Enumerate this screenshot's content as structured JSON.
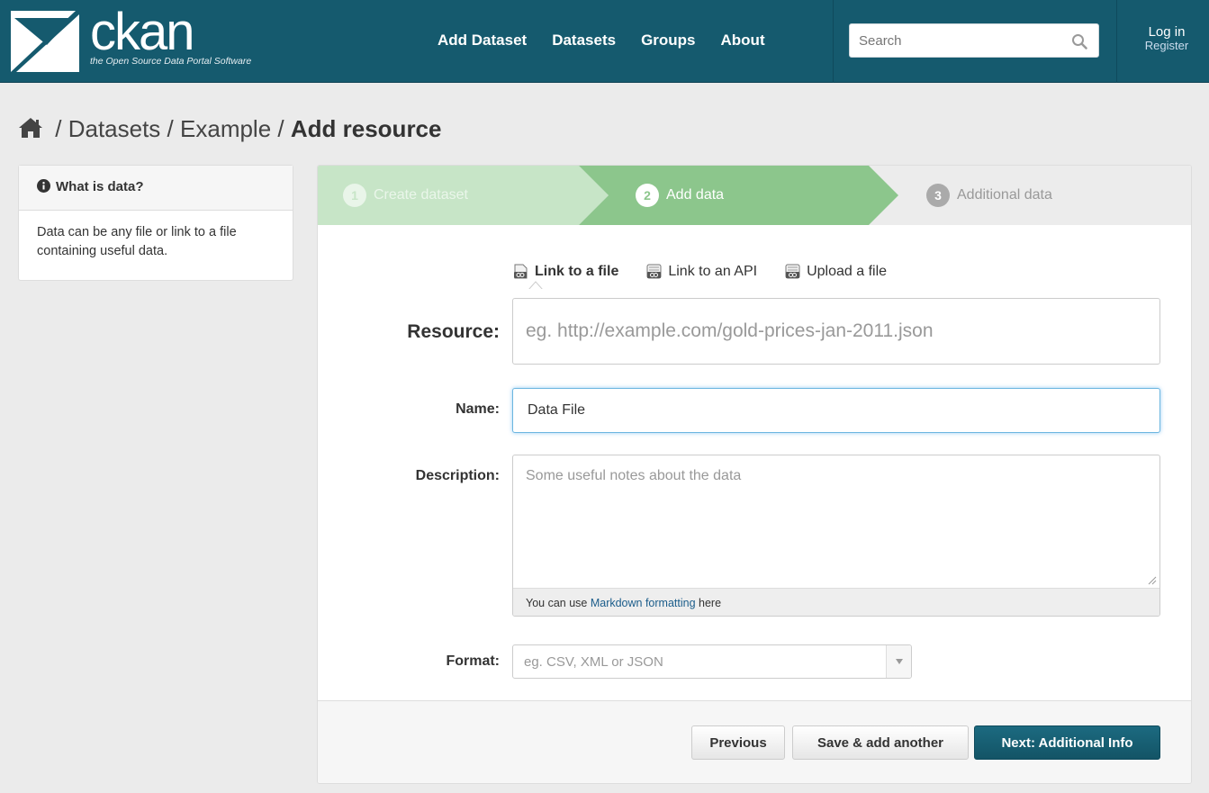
{
  "header": {
    "logo_word": "ckan",
    "logo_tagline": "the Open Source Data Portal Software",
    "nav": [
      "Add Dataset",
      "Datasets",
      "Groups",
      "About"
    ],
    "search_placeholder": "Search",
    "login": "Log in",
    "register": "Register"
  },
  "breadcrumb": {
    "items": [
      "Datasets",
      "Example"
    ],
    "active": "Add resource",
    "separator": "/"
  },
  "sidebar": {
    "title": "What is data?",
    "body": "Data can be any file or link to a file containing useful data."
  },
  "stages": [
    {
      "num": "1",
      "label": "Create dataset",
      "state": "complete"
    },
    {
      "num": "2",
      "label": "Add data",
      "state": "active"
    },
    {
      "num": "3",
      "label": "Additional data",
      "state": "upcoming"
    }
  ],
  "resource_types": [
    {
      "label": "Link to a file",
      "active": true
    },
    {
      "label": "Link to an API",
      "active": false
    },
    {
      "label": "Upload a file",
      "active": false
    }
  ],
  "form": {
    "resource_label": "Resource:",
    "resource_placeholder": "eg. http://example.com/gold-prices-jan-2011.json",
    "name_label": "Name:",
    "name_value": "Data File",
    "description_label": "Description:",
    "description_placeholder": "Some useful notes about the data",
    "markdown_pre": "You can use ",
    "markdown_link": "Markdown formatting",
    "markdown_post": " here",
    "format_label": "Format:",
    "format_placeholder": "eg. CSV, XML or JSON"
  },
  "actions": {
    "previous": "Previous",
    "save_add_another": "Save & add another",
    "next": "Next: Additional Info"
  },
  "colors": {
    "masthead": "#155a6e",
    "stage_complete": "#c7e5c7",
    "stage_active": "#8cc68c",
    "stage_upcoming": "#ececec",
    "primary_button": "#155a6e"
  }
}
